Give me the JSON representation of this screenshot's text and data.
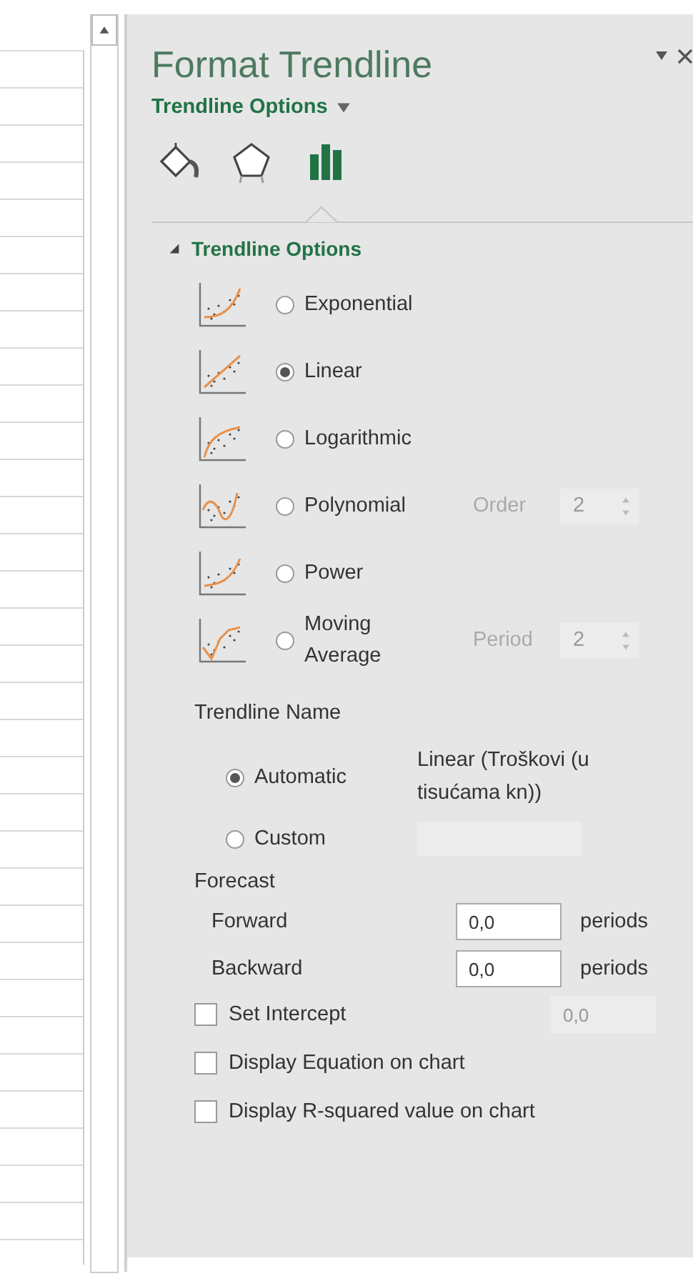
{
  "pane": {
    "title": "Format Trendline",
    "category": "Trendline Options",
    "icon_tabs": [
      {
        "kind": "fill",
        "selected": false
      },
      {
        "kind": "effects",
        "selected": false
      },
      {
        "kind": "options",
        "selected": true
      }
    ],
    "section": {
      "title": "Trendline Options",
      "expanded": true
    },
    "trend_types": [
      {
        "kind": "exponential",
        "label": "Exponential",
        "selected": false
      },
      {
        "kind": "linear",
        "label": "Linear",
        "selected": true
      },
      {
        "kind": "logarithmic",
        "label": "Logarithmic",
        "selected": false
      },
      {
        "kind": "polynomial",
        "label": "Polynomial",
        "selected": false,
        "param": {
          "label": "Order",
          "value": "2",
          "disabled": true
        }
      },
      {
        "kind": "power",
        "label": "Power",
        "selected": false
      },
      {
        "kind": "moving_average",
        "label": "Moving Average",
        "selected": false,
        "param": {
          "label": "Period",
          "value": "2",
          "disabled": true
        }
      }
    ],
    "name_heading": "Trendline Name",
    "name_options": [
      {
        "label": "Automatic",
        "selected": true,
        "text": "Linear (Troškovi (u tisućama kn))"
      },
      {
        "label": "Custom",
        "selected": false
      }
    ],
    "forecast_heading": "Forecast",
    "forecast": [
      {
        "label": "Forward",
        "value": "0,0",
        "unit": "periods"
      },
      {
        "label": "Backward",
        "value": "0,0",
        "unit": "periods"
      }
    ],
    "checkboxes": [
      {
        "label": "Set Intercept",
        "checked": false,
        "value": "0,0",
        "disabled": true
      },
      {
        "label": "Display Equation on chart",
        "checked": false
      },
      {
        "label": "Display R-squared value on chart",
        "checked": false
      }
    ]
  }
}
